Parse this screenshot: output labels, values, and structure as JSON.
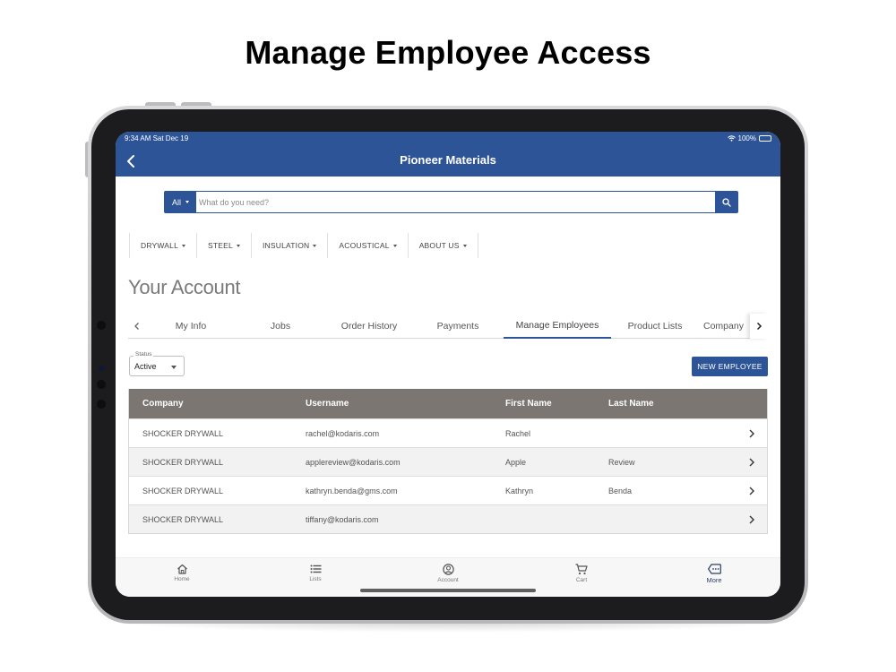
{
  "headline": "Manage Employee Access",
  "status_bar": {
    "time": "9:34 AM  Sat Dec 19",
    "battery": "100%"
  },
  "app": {
    "title": "Pioneer Materials"
  },
  "search": {
    "scope": "All",
    "placeholder": "What do you need?"
  },
  "categories": [
    "DRYWALL",
    "STEEL",
    "INSULATION",
    "ACOUSTICAL",
    "ABOUT US"
  ],
  "account": {
    "title": "Your Account"
  },
  "tabs": [
    "My Info",
    "Jobs",
    "Order History",
    "Payments",
    "Manage Employees",
    "Product Lists",
    "Company"
  ],
  "active_tab": "Manage Employees",
  "filter": {
    "label": "Status",
    "value": "Active"
  },
  "new_employee_label": "NEW EMPLOYEE",
  "table": {
    "headers": [
      "Company",
      "Username",
      "First Name",
      "Last Name"
    ],
    "rows": [
      [
        "SHOCKER DRYWALL",
        "rachel@kodaris.com",
        "Rachel",
        ""
      ],
      [
        "SHOCKER DRYWALL",
        "applereview@kodaris.com",
        "Apple",
        "Review"
      ],
      [
        "SHOCKER DRYWALL",
        "kathryn.benda@gms.com",
        "Kathryn",
        "Benda"
      ],
      [
        "SHOCKER DRYWALL",
        "tiffany@kodaris.com",
        "",
        ""
      ]
    ]
  },
  "bottom_nav": [
    {
      "label": "Home",
      "icon": "home-icon"
    },
    {
      "label": "Lists",
      "icon": "list-icon"
    },
    {
      "label": "Account",
      "icon": "account-icon"
    },
    {
      "label": "Cart",
      "icon": "cart-icon"
    },
    {
      "label": "More",
      "icon": "more-icon"
    }
  ],
  "colors": {
    "brand": "#2c5496",
    "table_header": "#7b7671"
  }
}
